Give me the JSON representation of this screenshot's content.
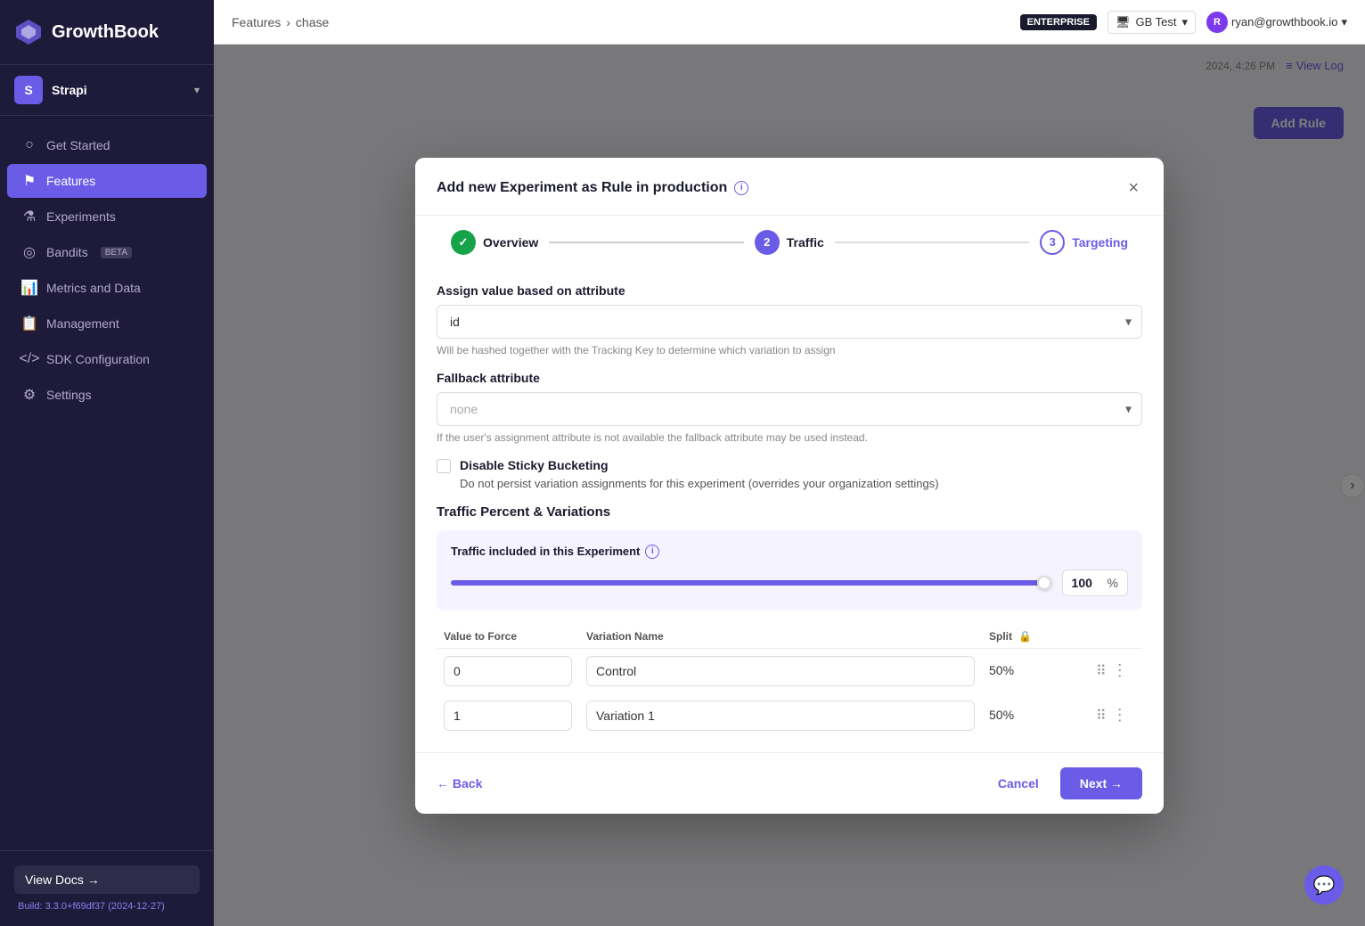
{
  "sidebar": {
    "logo_text": "GrowthBook",
    "workspace": {
      "initial": "S",
      "name": "Strapi",
      "chevron": "▾"
    },
    "nav_items": [
      {
        "id": "get-started",
        "label": "Get Started",
        "icon": "○"
      },
      {
        "id": "features",
        "label": "Features",
        "icon": "⚑",
        "active": true
      },
      {
        "id": "experiments",
        "label": "Experiments",
        "icon": "⚗"
      },
      {
        "id": "bandits",
        "label": "Bandits",
        "icon": "◎",
        "badge": "BETA"
      },
      {
        "id": "metrics",
        "label": "Metrics and Data",
        "icon": "📊"
      },
      {
        "id": "management",
        "label": "Management",
        "icon": "📋"
      },
      {
        "id": "sdk",
        "label": "SDK Configuration",
        "icon": "<>"
      },
      {
        "id": "settings",
        "label": "Settings",
        "icon": "⚙"
      }
    ],
    "view_docs": "View Docs →",
    "build_info": "Build: 3.3.0+f69df37 (2024-12-27)"
  },
  "topbar": {
    "breadcrumb_feature": "Features",
    "breadcrumb_sep": "›",
    "breadcrumb_page": "chase",
    "enterprise_badge": "ENTERPRISE",
    "org_name": "GB Test",
    "user_email": "ryan@growthbook.io",
    "user_initial": "R"
  },
  "background": {
    "timestamp": "2024, 4:26 PM",
    "view_log": "View Log",
    "add_rule": "Add Rule"
  },
  "modal": {
    "title": "Add new Experiment as Rule in production",
    "close_label": "×",
    "steps": [
      {
        "id": "overview",
        "label": "Overview",
        "state": "done",
        "number": "✓"
      },
      {
        "id": "traffic",
        "label": "Traffic",
        "state": "active",
        "number": "2"
      },
      {
        "id": "targeting",
        "label": "Targeting",
        "state": "pending",
        "number": "3"
      }
    ],
    "assign_attribute": {
      "label": "Assign value based on attribute",
      "value": "id",
      "hint": "Will be hashed together with the Tracking Key to determine which variation to assign"
    },
    "fallback_attribute": {
      "label": "Fallback attribute",
      "placeholder": "none",
      "hint": "If the user's assignment attribute is not available the fallback attribute may be used instead."
    },
    "sticky_bucketing": {
      "label": "Disable Sticky Bucketing",
      "description": "Do not persist variation assignments for this experiment (overrides your organization settings)"
    },
    "traffic_section": {
      "title": "Traffic Percent & Variations",
      "included_label": "Traffic included in this Experiment",
      "percent_value": "100",
      "percent_sign": "%",
      "slider_fill_width": "100%"
    },
    "variations_table": {
      "col_force": "Value to Force",
      "col_name": "Variation Name",
      "col_split": "Split",
      "rows": [
        {
          "value": "0",
          "name": "Control",
          "split": "50%"
        },
        {
          "value": "1",
          "name": "Variation 1",
          "split": "50%"
        }
      ]
    },
    "footer": {
      "back_label": "← Back",
      "cancel_label": "Cancel",
      "next_label": "Next →"
    }
  }
}
